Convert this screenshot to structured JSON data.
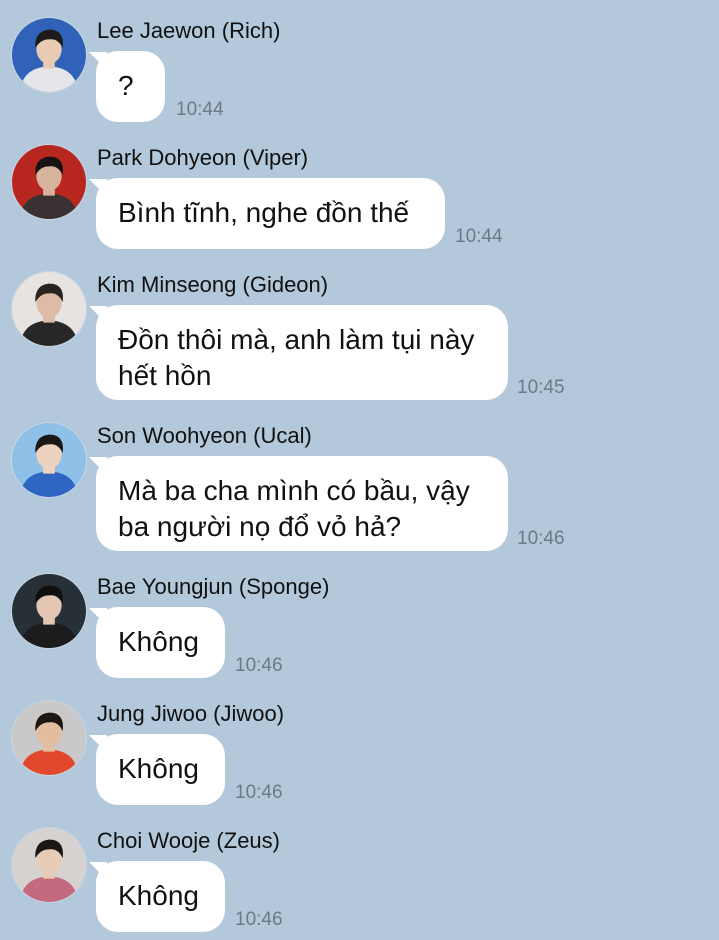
{
  "colors": {
    "background": "#b3c8db",
    "bubble": "#ffffff",
    "timestamp": "#6d7a86",
    "text": "#111111"
  },
  "messages": [
    {
      "sender": "Lee Jaewon (Rich)",
      "text": "?",
      "time": "10:44",
      "avatar": {
        "icon": "avatar-photo",
        "bg": "#2f62b8",
        "hair": "#1d1a1a",
        "skin": "#e9cbb4",
        "shirt": "#e4e6ea"
      }
    },
    {
      "sender": "Park Dohyeon (Viper)",
      "text": "Bình tĩnh, nghe đồn thế",
      "time": "10:44",
      "avatar": {
        "icon": "avatar-photo",
        "bg": "#b8271f",
        "hair": "#171313",
        "skin": "#d6b39c",
        "shirt": "#3a3232"
      }
    },
    {
      "sender": "Kim Minseong (Gideon)",
      "text": "Đồn thôi mà, anh làm tụi này hết hồn",
      "time": "10:45",
      "avatar": {
        "icon": "avatar-photo",
        "bg": "#e7e3e1",
        "hair": "#2a2420",
        "skin": "#dcbba7",
        "shirt": "#272727"
      }
    },
    {
      "sender": "Son Woohyeon (Ucal)",
      "text": "Mà ba cha mình có bầu, vậy ba người nọ đổ vỏ hả?",
      "time": "10:46",
      "avatar": {
        "icon": "avatar-photo",
        "bg": "#8fc0e8",
        "hair": "#1a1717",
        "skin": "#edd2bf",
        "shirt": "#2f66c4"
      }
    },
    {
      "sender": "Bae Youngjun (Sponge)",
      "text": "Không",
      "time": "10:46",
      "avatar": {
        "icon": "avatar-photo",
        "bg": "#263036",
        "hair": "#0f0f10",
        "skin": "#e2c6b2",
        "shirt": "#1c1c1e"
      }
    },
    {
      "sender": "Jung Jiwoo (Jiwoo)",
      "text": "Không",
      "time": "10:46",
      "avatar": {
        "icon": "avatar-photo",
        "bg": "#c9c9c9",
        "hair": "#1d1714",
        "skin": "#e3bd9f",
        "shirt": "#e2482b"
      }
    },
    {
      "sender": "Choi Wooje (Zeus)",
      "text": "Không",
      "time": "10:46",
      "avatar": {
        "icon": "avatar-photo",
        "bg": "#d6d2cf",
        "hair": "#1a1614",
        "skin": "#e8cbb5",
        "shirt": "#c46a80"
      }
    }
  ]
}
